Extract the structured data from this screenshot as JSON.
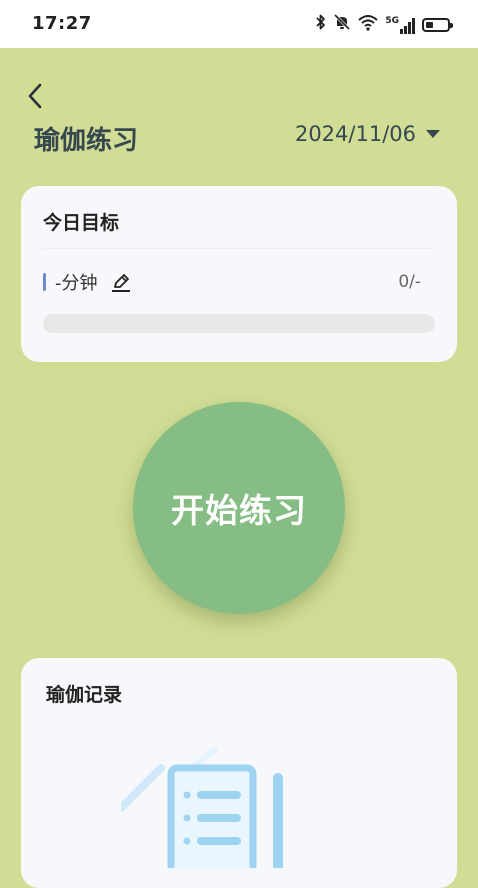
{
  "status_bar": {
    "time": "17:27",
    "icons": [
      "bluetooth-icon",
      "mute-icon",
      "wifi-icon",
      "signal-5g-icon",
      "battery-icon"
    ],
    "network_label": "5G",
    "battery_level": 0.35
  },
  "header": {
    "title": "瑜伽练习",
    "date": "2024/11/06"
  },
  "goal_card": {
    "title": "今日目标",
    "minutes_label": "-分钟",
    "progress_text": "0/-",
    "progress_fraction": 0
  },
  "start_button": {
    "label": "开始练习"
  },
  "record_card": {
    "title": "瑜伽记录"
  },
  "colors": {
    "background": "#d1dd94",
    "accent_green": "#85bd84",
    "goal_mark_blue": "#6e8ccd",
    "illustration_blue": "#9fd3f2"
  }
}
